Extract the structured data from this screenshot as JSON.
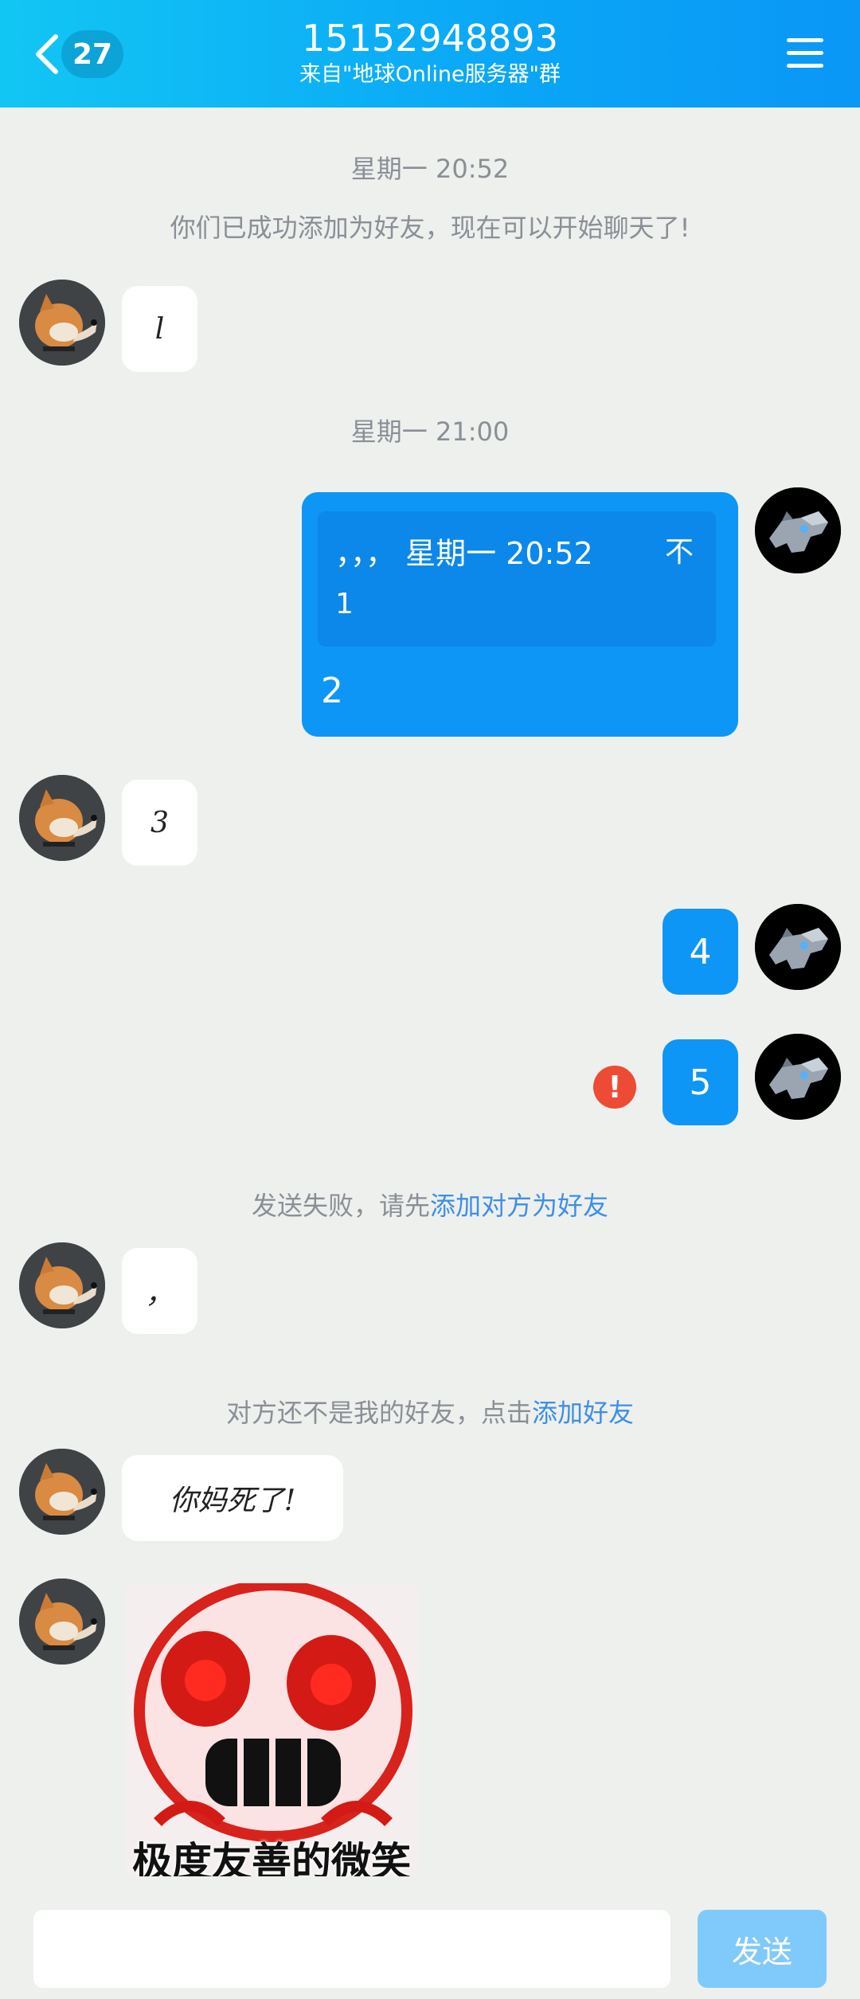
{
  "header": {
    "badge_count": "27",
    "title": "15152948893",
    "subtitle": "来自\"地球Online服务器\"群"
  },
  "chat": {
    "timestamp_1": "星期一 20:52",
    "sys_added": "你们已成功添加为好友，现在可以开始聊天了!",
    "msg_1": "l",
    "timestamp_2": "星期一 21:00",
    "quote_header": "，，， 星期一 20:52",
    "quote_pin": "不",
    "quote_body": "1",
    "msg_2": "2",
    "msg_3": "3",
    "msg_4": "4",
    "msg_5": "5",
    "err_glyph": "!",
    "send_fail_text": "发送失败，请先",
    "send_fail_link": "添加对方为好友",
    "msg_6": "，",
    "not_friend_text": "对方还不是我的好友，点击",
    "not_friend_link": "添加好友",
    "msg_7": "你妈死了!",
    "sticker_caption": "极度友善的微笑"
  },
  "input": {
    "placeholder": "",
    "send_label": "发送"
  },
  "colors": {
    "header_start": "#12c6f4",
    "header_end": "#0a97f6",
    "outgoing_bubble": "#0d96f6",
    "error": "#ee4b34",
    "link": "#3d8fe8",
    "send_disabled": "#80c9fb"
  },
  "icons": [
    "back-chevron-icon",
    "menu-icon",
    "error-icon",
    "shiba-avatar",
    "robot-wolf-avatar"
  ]
}
